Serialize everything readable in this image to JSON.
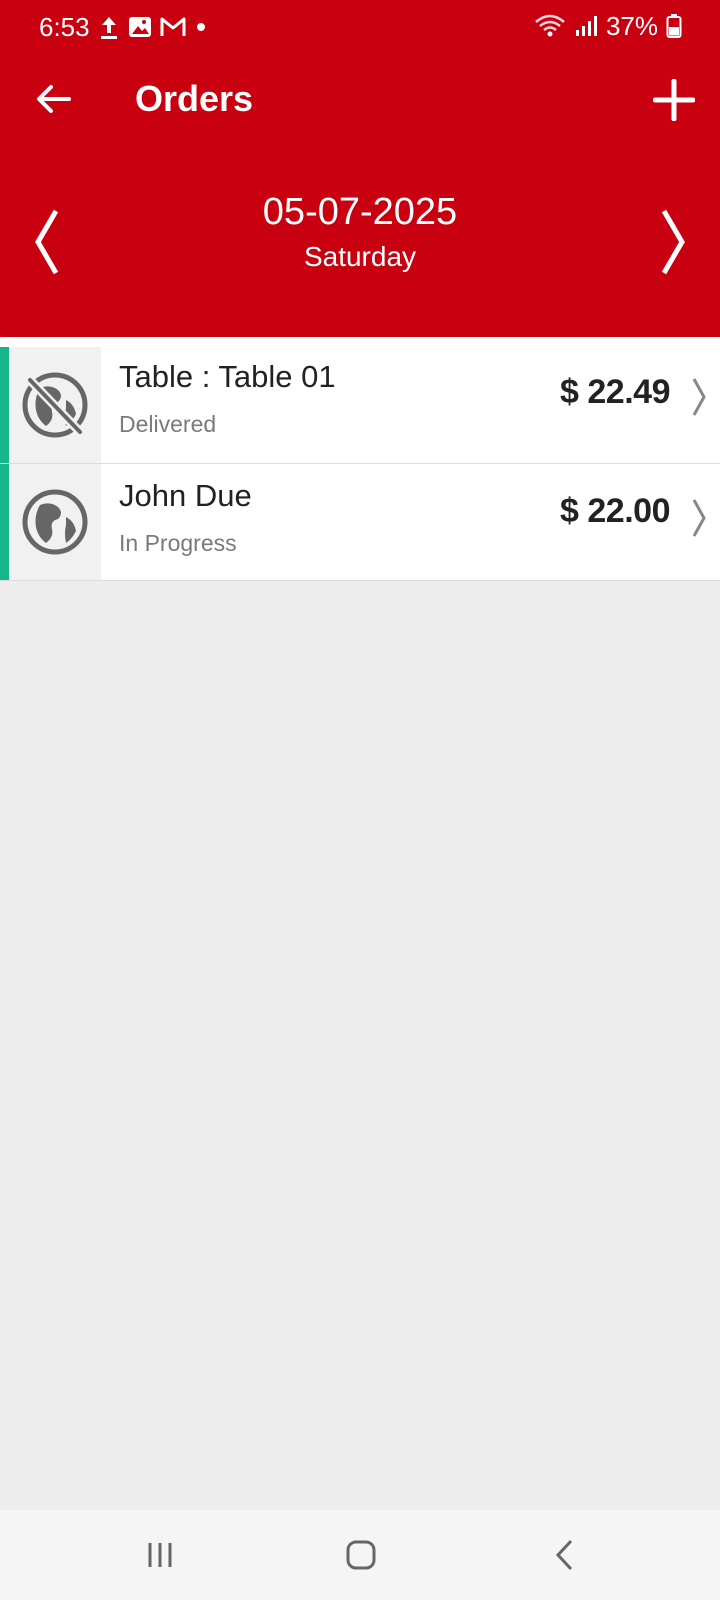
{
  "status_bar": {
    "time": "6:53",
    "battery": "37%",
    "icons": [
      "upload-icon",
      "gallery-icon",
      "gmail-icon",
      "dot-icon",
      "wifi-icon",
      "signal-icon",
      "battery-icon"
    ]
  },
  "app_bar": {
    "title": "Orders",
    "back_icon": "arrow-left-icon",
    "add_icon": "plus-icon"
  },
  "date_nav": {
    "date": "05-07-2025",
    "day": "Saturday"
  },
  "orders": [
    {
      "name": "Table : Table 01",
      "status": "Delivered",
      "amount": "$ 22.49",
      "icon": "globe-off-icon"
    },
    {
      "name": "John Due",
      "status": "In Progress",
      "amount": "$ 22.00",
      "icon": "globe-icon"
    }
  ],
  "colors": {
    "primary": "#c8000f",
    "accent": "#16b58a",
    "background": "#ededed"
  },
  "system_nav": [
    "recents-icon",
    "home-icon",
    "back-icon"
  ]
}
